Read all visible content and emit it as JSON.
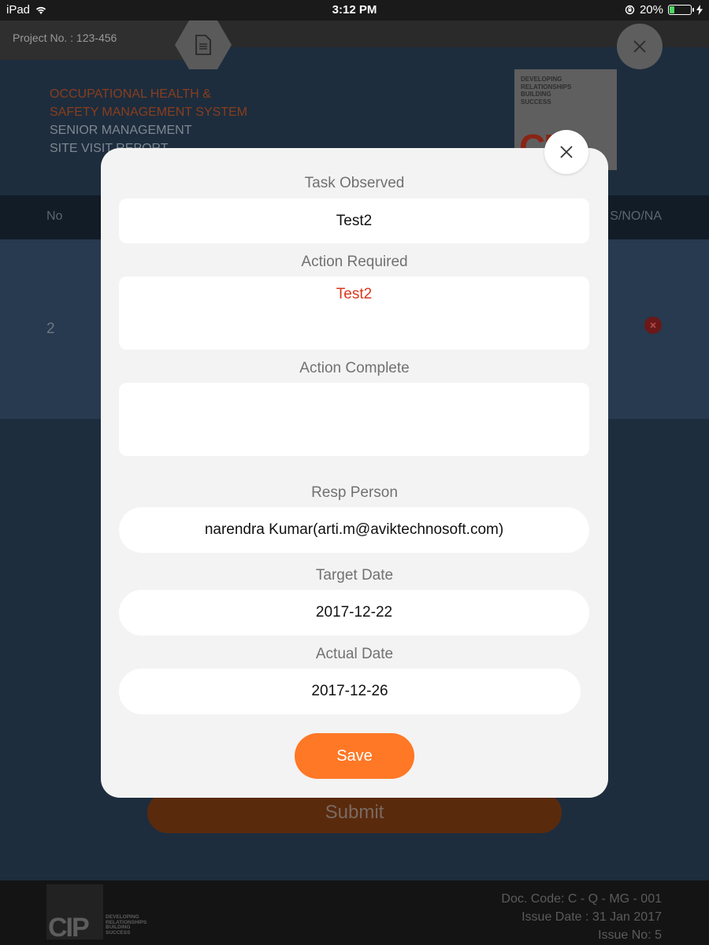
{
  "status_bar": {
    "device": "iPad",
    "time": "3:12 PM",
    "battery_percent": "20%",
    "battery_level": 0.2,
    "icons": [
      "wifi-icon",
      "rotation-lock-icon",
      "battery-icon",
      "charging-bolt-icon"
    ]
  },
  "background": {
    "project_no": "Project No. : 123-456",
    "title_lines": [
      "OCCUPATIONAL HEALTH &",
      "SAFETY MANAGEMENT SYSTEM",
      "SENIOR MANAGEMENT",
      "SITE VISIT REPORT"
    ],
    "logo_tagline": [
      "DEVELOPING",
      "RELATIONSHIPS",
      "BUILDING",
      "SUCCESS"
    ],
    "logo_text": "CIP",
    "table": {
      "col_no": "No",
      "col_status": "S/NO/NA",
      "row_no": "2"
    },
    "submit_label": "Submit",
    "footer": {
      "logo_text": "CIP",
      "tagline": [
        "DEVELOPING",
        "RELATIONSHIPS",
        "BUILDING",
        "SUCCESS"
      ],
      "doc_code": "Doc. Code: C - Q - MG - 001",
      "issue_date": "Issue Date : 31 Jan 2017",
      "issue_no": "Issue No: 5"
    }
  },
  "modal": {
    "task_observed_label": "Task Observed",
    "task_observed_value": "Test2",
    "action_required_label": "Action Required",
    "action_required_value": "Test2",
    "action_complete_label": "Action Complete",
    "action_complete_value": "",
    "resp_person_label": "Resp Person",
    "resp_person_value": "narendra Kumar(arti.m@aviktechnosoft.com)",
    "target_date_label": "Target Date",
    "target_date_value": "2017-12-22",
    "actual_date_label": "Actual Date",
    "actual_date_value": "2017-12-26",
    "save_label": "Save"
  },
  "colors": {
    "accent_orange": "#fe7826",
    "required_text_red": "#d9391c",
    "modal_bg": "#f3f3f3"
  }
}
